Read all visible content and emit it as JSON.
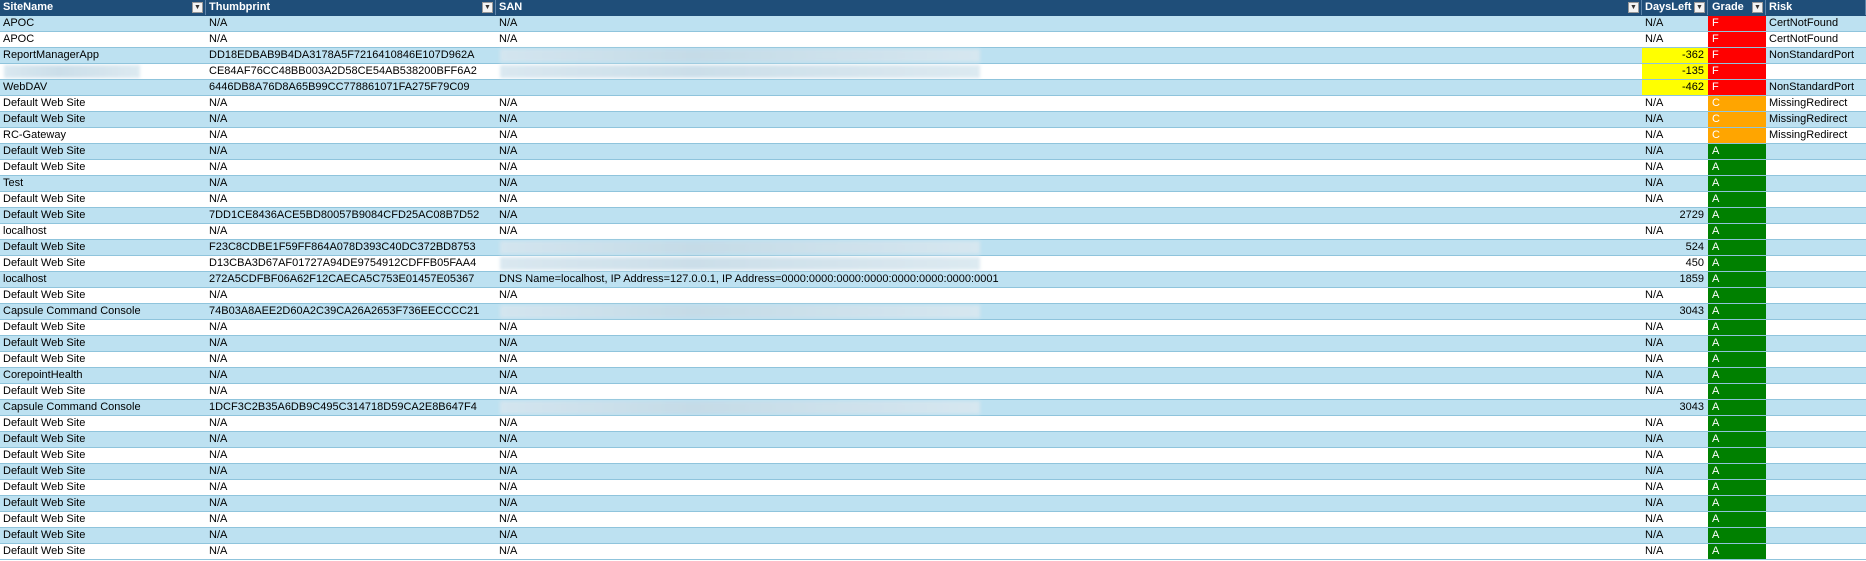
{
  "table": {
    "headers": {
      "site": "SiteName",
      "thumbprint": "Thumbprint",
      "san": "SAN",
      "days": "DaysLeft",
      "grade": "Grade",
      "risk": "Risk"
    },
    "filter_icon": "dropdown-arrow-icon",
    "colors": {
      "header": "#1f4e79",
      "band": "#bde1f1",
      "grade_F": "#ff0000",
      "grade_C": "#ffa500",
      "grade_A": "#008000",
      "days_warning": "#ffff00"
    },
    "rows": [
      {
        "site": "APOC",
        "thumbprint": "N/A",
        "san": "N/A",
        "days": "N/A",
        "grade": "F",
        "risk": "CertNotFound"
      },
      {
        "site": "APOC",
        "thumbprint": "N/A",
        "san": "N/A",
        "days": "N/A",
        "grade": "F",
        "risk": "CertNotFound"
      },
      {
        "site": "ReportManagerApp",
        "thumbprint": "DD18EDBAB9B4DA3178A5F7216410846E107D962A",
        "san": "",
        "san_redacted": true,
        "days": "-362",
        "grade": "F",
        "risk": "NonStandardPort",
        "warn": true
      },
      {
        "site": "",
        "site_redacted": true,
        "thumbprint": "CE84AF76CC48BB003A2D58CE54AB538200BFF6A2",
        "san": "",
        "san_redacted": true,
        "days": "-135",
        "grade": "F",
        "risk": "",
        "warn": true
      },
      {
        "site": "WebDAV",
        "thumbprint": "6446DB8A76D8A65B99CC778861071FA275F79C09",
        "san": "",
        "days": "-462",
        "grade": "F",
        "risk": "NonStandardPort",
        "warn": true
      },
      {
        "site": "Default Web Site",
        "thumbprint": "N/A",
        "san": "N/A",
        "days": "N/A",
        "grade": "C",
        "risk": "MissingRedirect"
      },
      {
        "site": "Default Web Site",
        "thumbprint": "N/A",
        "san": "N/A",
        "days": "N/A",
        "grade": "C",
        "risk": "MissingRedirect"
      },
      {
        "site": "RC-Gateway",
        "thumbprint": "N/A",
        "san": "N/A",
        "days": "N/A",
        "grade": "C",
        "risk": "MissingRedirect"
      },
      {
        "site": "Default Web Site",
        "thumbprint": "N/A",
        "san": "N/A",
        "days": "N/A",
        "grade": "A",
        "risk": ""
      },
      {
        "site": "Default Web Site",
        "thumbprint": "N/A",
        "san": "N/A",
        "days": "N/A",
        "grade": "A",
        "risk": ""
      },
      {
        "site": "Test",
        "thumbprint": "N/A",
        "san": "N/A",
        "days": "N/A",
        "grade": "A",
        "risk": ""
      },
      {
        "site": "Default Web Site",
        "thumbprint": "N/A",
        "san": "N/A",
        "days": "N/A",
        "grade": "A",
        "risk": ""
      },
      {
        "site": "Default Web Site",
        "thumbprint": "7DD1CE8436ACE5BD80057B9084CFD25AC08B7D52",
        "san": "N/A",
        "days": "2729",
        "grade": "A",
        "risk": ""
      },
      {
        "site": "localhost",
        "thumbprint": "N/A",
        "san": "N/A",
        "days": "N/A",
        "grade": "A",
        "risk": ""
      },
      {
        "site": "Default Web Site",
        "thumbprint": "F23C8CDBE1F59FF864A078D393C40DC372BD8753",
        "san": "",
        "san_redacted": true,
        "days": "524",
        "grade": "A",
        "risk": ""
      },
      {
        "site": "Default Web Site",
        "thumbprint": "D13CBA3D67AF01727A94DE9754912CDFFB05FAA4",
        "san": "",
        "san_redacted": true,
        "days": "450",
        "grade": "A",
        "risk": ""
      },
      {
        "site": "localhost",
        "thumbprint": "272A5CDFBF06A62F12CAECA5C753E01457E05367",
        "san": "DNS Name=localhost, IP Address=127.0.0.1, IP Address=0000:0000:0000:0000:0000:0000:0000:0001",
        "days": "1859",
        "grade": "A",
        "risk": ""
      },
      {
        "site": "Default Web Site",
        "thumbprint": "N/A",
        "san": "N/A",
        "days": "N/A",
        "grade": "A",
        "risk": ""
      },
      {
        "site": "Capsule Command Console",
        "thumbprint": "74B03A8AEE2D60A2C39CA26A2653F736EECCCC21",
        "san": "",
        "san_redacted": true,
        "days": "3043",
        "grade": "A",
        "risk": ""
      },
      {
        "site": "Default Web Site",
        "thumbprint": "N/A",
        "san": "N/A",
        "days": "N/A",
        "grade": "A",
        "risk": ""
      },
      {
        "site": "Default Web Site",
        "thumbprint": "N/A",
        "san": "N/A",
        "days": "N/A",
        "grade": "A",
        "risk": ""
      },
      {
        "site": "Default Web Site",
        "thumbprint": "N/A",
        "san": "N/A",
        "days": "N/A",
        "grade": "A",
        "risk": ""
      },
      {
        "site": "CorepointHealth",
        "thumbprint": "N/A",
        "san": "N/A",
        "days": "N/A",
        "grade": "A",
        "risk": ""
      },
      {
        "site": "Default Web Site",
        "thumbprint": "N/A",
        "san": "N/A",
        "days": "N/A",
        "grade": "A",
        "risk": ""
      },
      {
        "site": "Capsule Command Console",
        "thumbprint": "1DCF3C2B35A6DB9C495C314718D59CA2E8B647F4",
        "san": "",
        "san_redacted": true,
        "days": "3043",
        "grade": "A",
        "risk": ""
      },
      {
        "site": "Default Web Site",
        "thumbprint": "N/A",
        "san": "N/A",
        "days": "N/A",
        "grade": "A",
        "risk": ""
      },
      {
        "site": "Default Web Site",
        "thumbprint": "N/A",
        "san": "N/A",
        "days": "N/A",
        "grade": "A",
        "risk": ""
      },
      {
        "site": "Default Web Site",
        "thumbprint": "N/A",
        "san": "N/A",
        "days": "N/A",
        "grade": "A",
        "risk": ""
      },
      {
        "site": "Default Web Site",
        "thumbprint": "N/A",
        "san": "N/A",
        "days": "N/A",
        "grade": "A",
        "risk": ""
      },
      {
        "site": "Default Web Site",
        "thumbprint": "N/A",
        "san": "N/A",
        "days": "N/A",
        "grade": "A",
        "risk": ""
      },
      {
        "site": "Default Web Site",
        "thumbprint": "N/A",
        "san": "N/A",
        "days": "N/A",
        "grade": "A",
        "risk": ""
      },
      {
        "site": "Default Web Site",
        "thumbprint": "N/A",
        "san": "N/A",
        "days": "N/A",
        "grade": "A",
        "risk": ""
      },
      {
        "site": "Default Web Site",
        "thumbprint": "N/A",
        "san": "N/A",
        "days": "N/A",
        "grade": "A",
        "risk": ""
      },
      {
        "site": "Default Web Site",
        "thumbprint": "N/A",
        "san": "N/A",
        "days": "N/A",
        "grade": "A",
        "risk": ""
      }
    ]
  }
}
